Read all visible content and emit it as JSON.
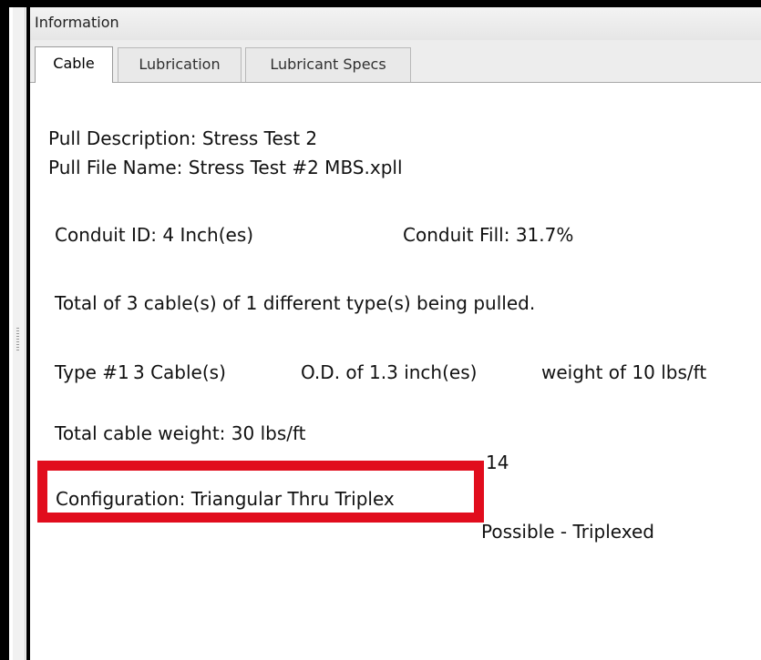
{
  "panel": {
    "title": "Information"
  },
  "tabs": [
    {
      "label": "Cable"
    },
    {
      "label": "Lubrication"
    },
    {
      "label": "Lubricant Specs"
    }
  ],
  "info": {
    "pull_description": "Pull Description: Stress Test 2",
    "pull_file_name": "Pull File Name: Stress Test #2 MBS.xpll",
    "conduit_id": "Conduit ID: 4  Inch(es)",
    "conduit_fill": "Conduit Fill: 31.7%",
    "total_cables": "Total of 3  cable(s) of 1  different type(s) being pulled.",
    "type_number": "Type #1",
    "type_count": "3  Cable(s)",
    "type_od": "O.D. of 1.3  inch(es)",
    "type_weight": "weight of 10  lbs/ft",
    "total_weight": "Total cable weight: 30  lbs/ft",
    "calc_weight_partial": "14",
    "configuration": "Configuration:  Triangular Thru Triplex",
    "jam_partial": "Possible - Triplexed"
  },
  "colors": {
    "highlight": "#e10d1d"
  }
}
